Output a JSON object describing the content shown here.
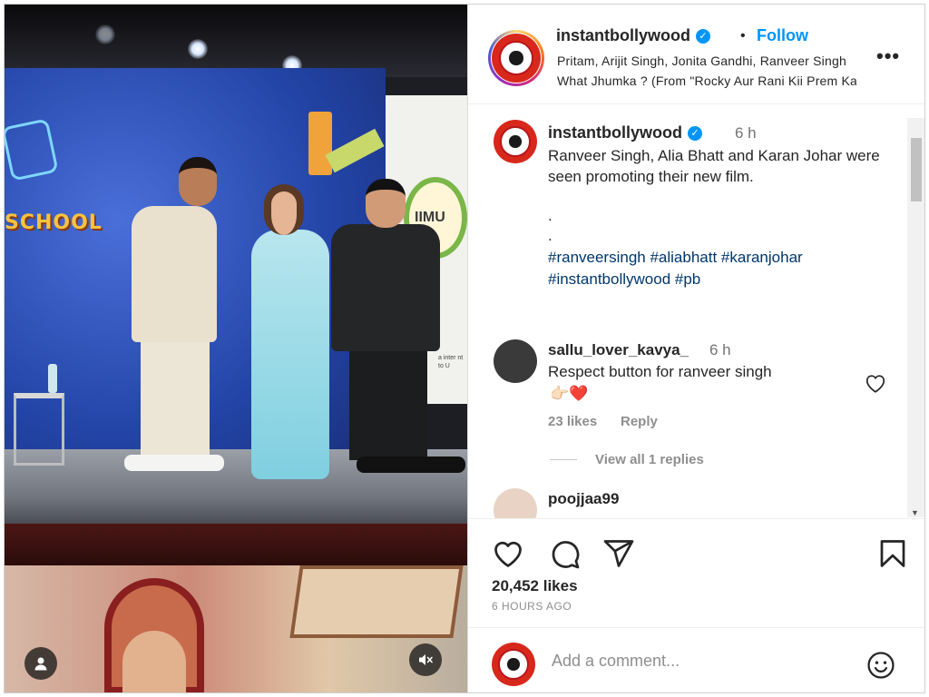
{
  "post": {
    "author": "instantbollywood",
    "follow_label": "Follow",
    "separator": "•",
    "audio_line_1": "Pritam, Arijit Singh, Jonita Gandhi, Ranveer Singh",
    "audio_line_2": "What Jhumka ? (From \"Rocky Aur Rani Kii Prem Kahaani\")",
    "more_label": "•••",
    "verified_glyph": "✓"
  },
  "media": {
    "wall_text": "SCHOOL",
    "banner_text": "IIMU",
    "banner_small": "a inter nt to U"
  },
  "caption": {
    "username": "instantbollywood",
    "time": "6 h",
    "text": "Ranveer Singh, Alia Bhatt and Karan Johar were seen promoting their new film.",
    "dot": ".",
    "hashtags": "#ranveersingh #aliabhatt #karanjohar #instantbollywood #pb"
  },
  "comments": [
    {
      "username": "sallu_lover_kavya_",
      "time": "6 h",
      "text": "Respect button for ranveer singh",
      "emoji": "👉🏻❤️",
      "likes": "23 likes",
      "reply_label": "Reply",
      "view_replies": "View all 1 replies"
    },
    {
      "username": "poojjaa99"
    }
  ],
  "stats": {
    "likes": "20,452 likes",
    "time_ago": "6 HOURS AGO"
  },
  "add_comment": {
    "placeholder": "Add a comment..."
  },
  "colors": {
    "accent": "#0095f6",
    "brand_red": "#d8281c",
    "hashtag": "#00376b",
    "muted": "#8e8e8e"
  },
  "icons": [
    "user-tag-icon",
    "mute-icon",
    "heart-icon",
    "comment-icon",
    "share-icon",
    "bookmark-icon",
    "emoji-icon",
    "verified-icon",
    "more-icon"
  ]
}
